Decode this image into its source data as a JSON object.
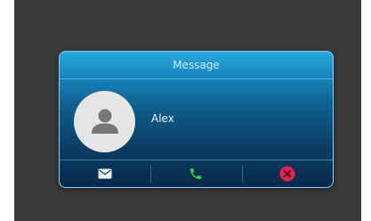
{
  "dialog": {
    "title": "Message",
    "contact_name": "Alex"
  },
  "icons": {
    "avatar": "person-icon",
    "message": "envelope-icon",
    "call": "phone-icon",
    "decline": "close-circle-icon"
  },
  "colors": {
    "call_icon": "#2fd83c",
    "decline_icon": "#e8204f",
    "avatar_bg": "#e6e6e6",
    "avatar_fg": "#777777",
    "envelope": "#ffffff"
  }
}
